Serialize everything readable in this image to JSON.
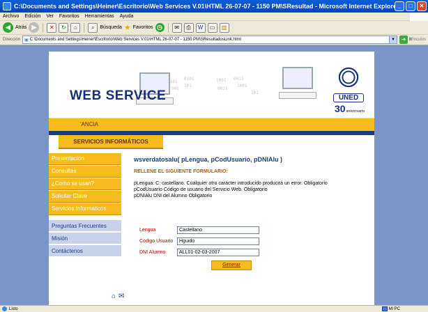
{
  "window": {
    "title": "C:\\Documents and Settings\\Heiner\\Escritorio\\Web Services V.01\\HTML 26-07-07 - 1150 PM\\SResultad - Microsoft Internet Explorer",
    "minimize": "_",
    "maximize": "□",
    "close": "✕"
  },
  "menu": [
    "Archivo",
    "Edición",
    "Ver",
    "Favoritos",
    "Herramientas",
    "Ayuda"
  ],
  "toolbar": {
    "back_label": "Atrás",
    "search_label": "Búsqueda",
    "favorites_label": "Favoritos"
  },
  "address": {
    "label": "Dirección",
    "value": "C:\\Documents and Settings\\Heiner\\Escritorio\\Web Services V.01\\HTML 26-07-07 - 1150 PM\\SResultadosLink.html",
    "go": "Ir",
    "links": "Vínculos"
  },
  "header": {
    "brand": "WEB SERVICE",
    "binary": [
      "0101",
      "0101",
      "1001",
      "0011",
      "001",
      "101",
      "0011",
      "1001",
      "101"
    ],
    "logo_text": "UNED",
    "logo_30": "30",
    "logo_sub": "aniversario"
  },
  "band": {
    "text": "'ANCIA"
  },
  "services_tab": "SERVICIOS INFORMÁTICOS",
  "nav": {
    "yellow": [
      "Presentacion",
      "Consultas",
      "¿Como se usan?",
      "Solicitar Clave",
      "Servicios Informaticos"
    ],
    "blue": [
      "Preguntas Frecuentes",
      "Misión",
      "Contáctenos"
    ]
  },
  "content": {
    "function": "wsverdatosalu( pLengua, pCodUsuario, pDNIAlu )",
    "subtitle": "RELLENE EL SIGUIENTE FORMULARIO:",
    "desc_1": "pLengua: C: castellano. Cualquier otro carácter introducido producirá un error. Obligatorio",
    "desc_2": "pCodUsuario Código de usuario del Servicio Web. Obligatorio",
    "desc_3": "pDNIAlu DNI del Alumno Obligatorio"
  },
  "form": {
    "lengua_label": "Lengua",
    "lengua_value": "Castellano",
    "codigo_label": "Codigo Usuario",
    "codigo_value": "Hguido",
    "dni_label": "DNI Alumno",
    "dni_value": "ALL01-02-03-2007",
    "submit": "Generar"
  },
  "footer": {
    "home_icon": "⌂",
    "mail_icon": "✉"
  },
  "status": {
    "text": "Listo",
    "zone": "Mi PC"
  }
}
